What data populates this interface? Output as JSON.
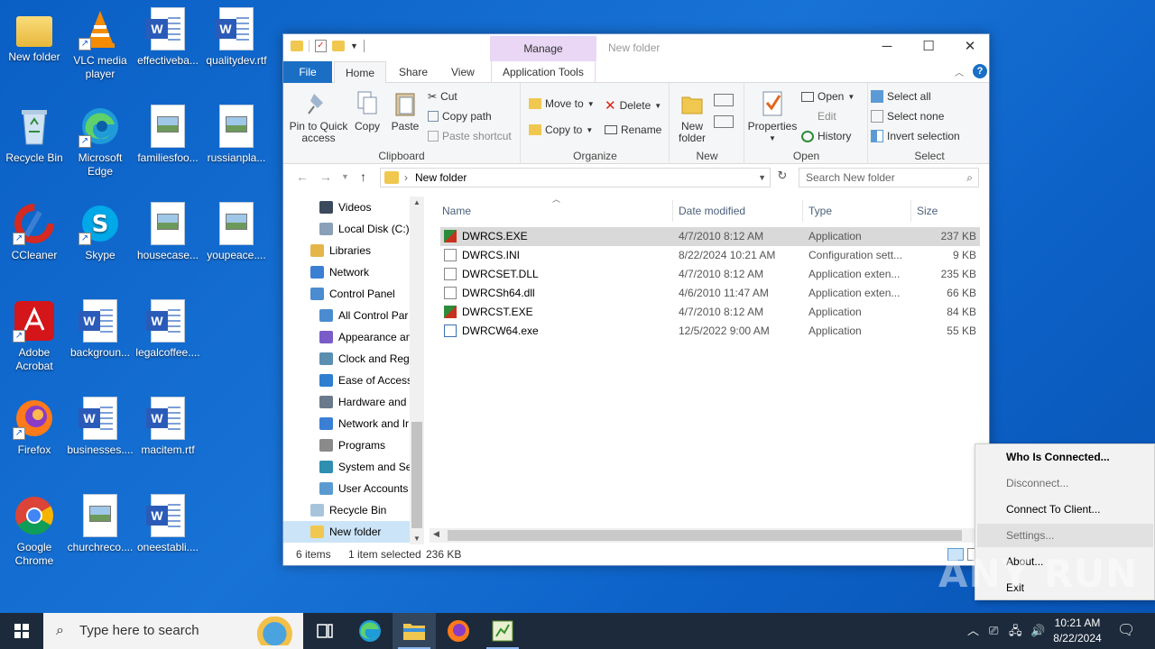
{
  "desktop": {
    "icons": [
      {
        "label": "New folder",
        "icon": "folder-icon"
      },
      {
        "label": "VLC media player",
        "icon": "vlc-icon"
      },
      {
        "label": "effectiveba...",
        "icon": "word-doc-icon"
      },
      {
        "label": "qualitydev.rtf",
        "icon": "word-doc-icon"
      },
      {
        "label": "Recycle Bin",
        "icon": "recycle-bin-icon"
      },
      {
        "label": "Microsoft Edge",
        "icon": "edge-icon"
      },
      {
        "label": "familiesfoo...",
        "icon": "image-file-icon"
      },
      {
        "label": "russianpla...",
        "icon": "image-file-icon"
      },
      {
        "label": "CCleaner",
        "icon": "ccleaner-icon"
      },
      {
        "label": "Skype",
        "icon": "skype-icon"
      },
      {
        "label": "housecase...",
        "icon": "image-file-icon"
      },
      {
        "label": "youpeace....",
        "icon": "image-file-icon"
      },
      {
        "label": "Adobe Acrobat",
        "icon": "acrobat-icon"
      },
      {
        "label": "backgroun...",
        "icon": "word-doc-icon"
      },
      {
        "label": "legalcoffee....",
        "icon": "word-doc-icon"
      },
      {
        "label": "Firefox",
        "icon": "firefox-icon"
      },
      {
        "label": "businesses....",
        "icon": "word-doc-icon"
      },
      {
        "label": "macitem.rtf",
        "icon": "word-doc-icon"
      },
      {
        "label": "Google Chrome",
        "icon": "chrome-icon"
      },
      {
        "label": "churchreco....",
        "icon": "image-file-icon"
      },
      {
        "label": "oneestabli....",
        "icon": "word-doc-icon"
      }
    ]
  },
  "explorer": {
    "title": "New folder",
    "manage_tab": "Manage",
    "tabs": [
      "File",
      "Home",
      "Share",
      "View",
      "Application Tools"
    ],
    "ribbon": {
      "clipboard": {
        "label": "Clipboard",
        "pin": "Pin to Quick access",
        "copy": "Copy",
        "paste": "Paste",
        "cut": "Cut",
        "copy_path": "Copy path",
        "paste_shortcut": "Paste shortcut"
      },
      "organize": {
        "label": "Organize",
        "move_to": "Move to",
        "copy_to": "Copy to",
        "delete": "Delete",
        "rename": "Rename"
      },
      "new": {
        "label": "New",
        "new_folder": "New folder"
      },
      "open": {
        "label": "Open",
        "properties": "Properties",
        "open": "Open",
        "edit": "Edit",
        "history": "History"
      },
      "select": {
        "label": "Select",
        "select_all": "Select all",
        "select_none": "Select none",
        "invert": "Invert selection"
      }
    },
    "address": {
      "path": "New folder",
      "search_placeholder": "Search New folder"
    },
    "nav": [
      {
        "label": "Videos",
        "icon": "videos-icon",
        "indent": 1
      },
      {
        "label": "Local Disk (C:)",
        "icon": "drive-icon",
        "indent": 1
      },
      {
        "label": "Libraries",
        "icon": "libraries-icon",
        "indent": 0
      },
      {
        "label": "Network",
        "icon": "network-icon",
        "indent": 0
      },
      {
        "label": "Control Panel",
        "icon": "control-panel-icon",
        "indent": 0
      },
      {
        "label": "All Control Par",
        "icon": "control-panel-icon",
        "indent": 1
      },
      {
        "label": "Appearance an",
        "icon": "appearance-icon",
        "indent": 1
      },
      {
        "label": "Clock and Regi",
        "icon": "clock-icon",
        "indent": 1
      },
      {
        "label": "Ease of Access",
        "icon": "ease-access-icon",
        "indent": 1
      },
      {
        "label": "Hardware and ",
        "icon": "hardware-icon",
        "indent": 1
      },
      {
        "label": "Network and Ir",
        "icon": "network-icon",
        "indent": 1
      },
      {
        "label": "Programs",
        "icon": "programs-icon",
        "indent": 1
      },
      {
        "label": "System and Se",
        "icon": "system-icon",
        "indent": 1
      },
      {
        "label": "User Accounts",
        "icon": "user-accounts-icon",
        "indent": 1
      },
      {
        "label": "Recycle Bin",
        "icon": "recycle-bin-icon",
        "indent": 0
      },
      {
        "label": "New folder",
        "icon": "folder-icon",
        "indent": 0
      }
    ],
    "columns": [
      "Name",
      "Date modified",
      "Type",
      "Size"
    ],
    "files": [
      {
        "name": "DWRCS.EXE",
        "date": "4/7/2010 8:12 AM",
        "type": "Application",
        "size": "237 KB",
        "icon": "app-icon"
      },
      {
        "name": "DWRCS.INI",
        "date": "8/22/2024 10:21 AM",
        "type": "Configuration sett...",
        "size": "9 KB",
        "icon": "config-file-icon"
      },
      {
        "name": "DWRCSET.DLL",
        "date": "4/7/2010 8:12 AM",
        "type": "Application exten...",
        "size": "235 KB",
        "icon": "dll-icon"
      },
      {
        "name": "DWRCSh64.dll",
        "date": "4/6/2010 11:47 AM",
        "type": "Application exten...",
        "size": "66 KB",
        "icon": "dll-icon"
      },
      {
        "name": "DWRCST.EXE",
        "date": "4/7/2010 8:12 AM",
        "type": "Application",
        "size": "84 KB",
        "icon": "app-icon"
      },
      {
        "name": "DWRCW64.exe",
        "date": "12/5/2022 9:00 AM",
        "type": "Application",
        "size": "55 KB",
        "icon": "exe-icon"
      }
    ],
    "status": {
      "count": "6 items",
      "selected": "1 item selected",
      "size": "236 KB"
    }
  },
  "context_menu": {
    "items": [
      {
        "label": "Who Is Connected...",
        "style": "bold"
      },
      {
        "label": "Disconnect...",
        "style": "dim"
      },
      {
        "label": "Connect To Client...",
        "style": "normal"
      },
      {
        "label": "Settings...",
        "style": "dim"
      },
      {
        "label": "About...",
        "style": "normal"
      },
      {
        "label": "Exit",
        "style": "normal"
      }
    ]
  },
  "taskbar": {
    "search_placeholder": "Type here to search",
    "time": "10:21 AM",
    "date": "8/22/2024"
  },
  "watermark": "ANY RUN"
}
